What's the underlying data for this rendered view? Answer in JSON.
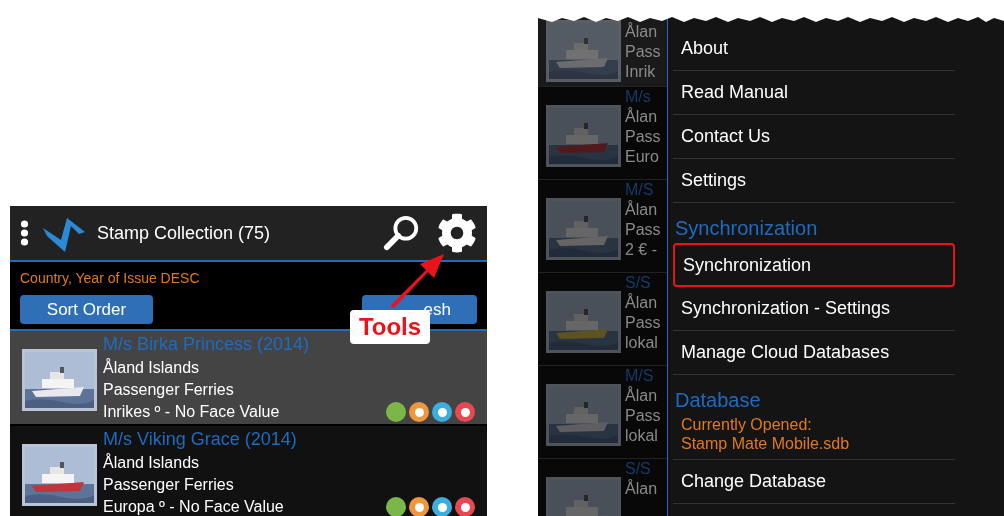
{
  "left": {
    "header": {
      "title": "Stamp Collection (75)"
    },
    "sort_label": "Country, Year of Issue DESC",
    "buttons": [
      {
        "label": "Sort Order"
      },
      {
        "label": "esh"
      }
    ],
    "callout": {
      "label": "Tools"
    },
    "rows": [
      {
        "title": "M/s Birka Princess (2014)",
        "country": "Åland Islands",
        "category": "Passenger Ferries",
        "value": "Inrikes º - No Face Value",
        "selected": true,
        "dots": [
          {
            "color": "#7ab648",
            "ring": false
          },
          {
            "color": "#f0963c",
            "ring": true
          },
          {
            "color": "#3caee0",
            "ring": true
          },
          {
            "color": "#e8484f",
            "ring": true
          }
        ]
      },
      {
        "title": "M/s Viking Grace (2014)",
        "country": "Åland Islands",
        "category": "Passenger Ferries",
        "value": "Europa º - No Face Value",
        "selected": false,
        "dots": [
          {
            "color": "#7ab648",
            "ring": false
          },
          {
            "color": "#f0963c",
            "ring": true
          },
          {
            "color": "#3caee0",
            "ring": true
          },
          {
            "color": "#e8484f",
            "ring": true
          }
        ]
      }
    ]
  },
  "right": {
    "background_rows": [
      {
        "lines": [
          "Ålan",
          "Pass",
          "Inrik"
        ]
      },
      {
        "title": "M/s",
        "lines": [
          "Ålan",
          "Pass",
          "Euro"
        ]
      },
      {
        "title": "M/S",
        "lines": [
          "Ålan",
          "Pass",
          "2 € -"
        ]
      },
      {
        "title": "S/S",
        "lines": [
          "Ålan",
          "Pass",
          "lokal"
        ]
      },
      {
        "title": "M/S",
        "lines": [
          "Ålan",
          "Pass",
          "lokal"
        ]
      },
      {
        "title": "S/S",
        "lines": [
          "Ålan"
        ]
      }
    ],
    "drawer": [
      {
        "kind": "item",
        "label": "About",
        "highlighted": false
      },
      {
        "kind": "item",
        "label": "Read Manual",
        "highlighted": false
      },
      {
        "kind": "item",
        "label": "Contact Us",
        "highlighted": false
      },
      {
        "kind": "item",
        "label": "Settings",
        "highlighted": false
      },
      {
        "kind": "heading",
        "label": "Synchronization"
      },
      {
        "kind": "item",
        "label": "Synchronization",
        "highlighted": true
      },
      {
        "kind": "item",
        "label": "Synchronization - Settings",
        "highlighted": false
      },
      {
        "kind": "item",
        "label": "Manage Cloud Databases",
        "highlighted": false
      },
      {
        "kind": "heading",
        "label": "Database"
      },
      {
        "kind": "info",
        "lines": [
          "Currently Opened:",
          "Stamp Mate Mobile.sdb"
        ]
      },
      {
        "kind": "item",
        "label": "Change Database",
        "highlighted": false
      }
    ]
  }
}
